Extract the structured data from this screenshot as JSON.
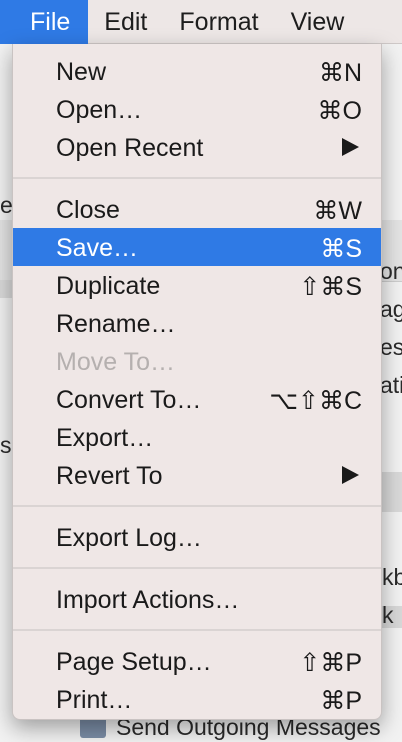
{
  "menubar": {
    "items": [
      {
        "label": "File",
        "active": true
      },
      {
        "label": "Edit",
        "active": false
      },
      {
        "label": "Format",
        "active": false
      },
      {
        "label": "View",
        "active": false
      }
    ]
  },
  "background_window": {
    "fragments": [
      "es",
      "on",
      "ag",
      "es",
      "ati",
      "s",
      "kb",
      "k",
      "Send Outgoing Messages"
    ]
  },
  "file_menu": {
    "items": [
      {
        "label": "New",
        "shortcut": "⌘N"
      },
      {
        "label": "Open…",
        "shortcut": "⌘O"
      },
      {
        "label": "Open Recent",
        "submenu": true
      },
      {
        "label": "Close",
        "shortcut": "⌘W"
      },
      {
        "label": "Save…",
        "shortcut": "⌘S",
        "highlighted": true
      },
      {
        "label": "Duplicate",
        "shortcut": "⇧⌘S"
      },
      {
        "label": "Rename…"
      },
      {
        "label": "Move To…",
        "disabled": true
      },
      {
        "label": "Convert To…",
        "shortcut": "⌥⇧⌘C"
      },
      {
        "label": "Export…"
      },
      {
        "label": "Revert To",
        "submenu": true
      },
      {
        "label": "Export Log…"
      },
      {
        "label": "Import Actions…"
      },
      {
        "label": "Page Setup…",
        "shortcut": "⇧⌘P"
      },
      {
        "label": "Print…",
        "shortcut": "⌘P"
      }
    ]
  },
  "colors": {
    "highlight": "#2f7ae5",
    "menu_background": "#efe7e6",
    "disabled_text": "#b5b0af"
  }
}
